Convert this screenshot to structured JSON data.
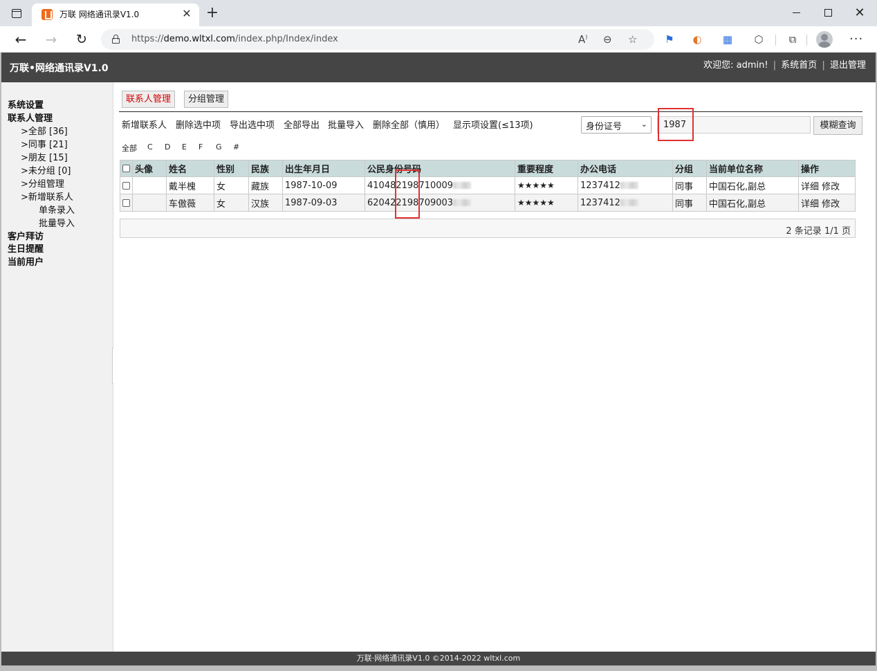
{
  "browser": {
    "tab_title": "万联 网络通讯录V1.0",
    "url_domain": "demo.wltxl.com",
    "url_prefix": "https://",
    "url_path": "/index.php/Index/index",
    "close_symbol": "✕",
    "newtab_symbol": "+"
  },
  "header": {
    "title": "万联•网络通讯录V1.0",
    "welcome": "欢迎您: admin!",
    "home_link": "系统首页",
    "logout_link": "退出管理"
  },
  "sidebar": {
    "system_settings": "系统设置",
    "contact_mgmt": "联系人管理",
    "all": ">全部 [36]",
    "colleague": ">同事 [21]",
    "friend": ">朋友 [15]",
    "ungrouped": ">未分组 [0]",
    "group_mgmt": ">分组管理",
    "add_contact": ">新增联系人",
    "single_entry": "单条录入",
    "batch_import": "批量导入",
    "customer_visit": "客户拜访",
    "birthday_reminder": "生日提醒",
    "current_user": "当前用户"
  },
  "tabs": {
    "contact_mgmt": "联系人管理",
    "group_mgmt": "分组管理"
  },
  "actions": {
    "add": "新增联系人",
    "delete_selected": "删除选中项",
    "export_selected": "导出选中项",
    "export_all": "全部导出",
    "batch_import": "批量导入",
    "delete_all": "删除全部（慎用）",
    "display_settings": "显示项设置(≤13项)"
  },
  "search": {
    "field": "身份证号",
    "value": "1987",
    "button": "模糊查询"
  },
  "letters": [
    "全部",
    "C",
    "D",
    "E",
    "F",
    "G",
    "#"
  ],
  "table": {
    "headers": [
      "头像",
      "姓名",
      "性别",
      "民族",
      "出生年月日",
      "公民身份号码",
      "重要程度",
      "办公电话",
      "分组",
      "当前单位名称",
      "操作"
    ],
    "rows": [
      {
        "name": "戴半槐",
        "gender": "女",
        "ethnicity": "藏族",
        "birth": "1987-10-09",
        "id_number": "410482198710009",
        "importance": "★★★★★",
        "phone": "1237412",
        "group": "同事",
        "company": "中国石化,副总",
        "detail": "详细",
        "edit": "修改"
      },
      {
        "name": "车傲薇",
        "gender": "女",
        "ethnicity": "汉族",
        "birth": "1987-09-03",
        "id_number": "620422198709003",
        "importance": "★★★★★",
        "phone": "1237412",
        "group": "同事",
        "company": "中国石化,副总",
        "detail": "详细",
        "edit": "修改"
      }
    ]
  },
  "pager": {
    "text": "2 条记录 1/1 页"
  },
  "footer": {
    "text": "万联·网络通讯录V1.0 ©2014-2022 wltxl.com"
  },
  "colors": {
    "header_bg": "#454545",
    "table_header_bg": "#c9dcdb",
    "active_tab_text": "#d40000",
    "highlight_box": "#e03030"
  }
}
